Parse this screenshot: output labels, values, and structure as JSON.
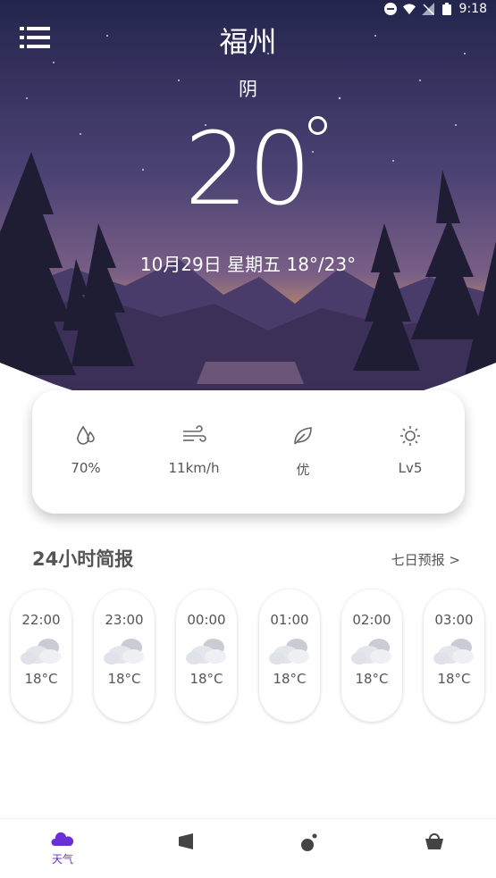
{
  "status": {
    "time": "9:18"
  },
  "header": {
    "city": "福州",
    "condition": "阴",
    "temperature": "20",
    "date_line": "10月29日  星期五  18°/23°"
  },
  "details": [
    {
      "icon": "humidity-icon",
      "value": "70%"
    },
    {
      "icon": "wind-icon",
      "value": "11km/h"
    },
    {
      "icon": "leaf-icon",
      "value": "优"
    },
    {
      "icon": "uv-sun-icon",
      "value": "Lv5"
    }
  ],
  "hourly_section": {
    "title": "24小时简报",
    "link": "七日预报  >"
  },
  "hourly": [
    {
      "time": "22:00",
      "temp": "18°C",
      "icon": "cloudy-icon"
    },
    {
      "time": "23:00",
      "temp": "18°C",
      "icon": "cloudy-icon"
    },
    {
      "time": "00:00",
      "temp": "18°C",
      "icon": "cloudy-icon"
    },
    {
      "time": "01:00",
      "temp": "18°C",
      "icon": "cloudy-icon"
    },
    {
      "time": "02:00",
      "temp": "18°C",
      "icon": "cloudy-icon"
    },
    {
      "time": "03:00",
      "temp": "18°C",
      "icon": "cloudy-icon"
    }
  ],
  "nav": [
    {
      "label": "天气",
      "icon": "cloud-icon",
      "active": true
    },
    {
      "label": "",
      "icon": "speaker-icon",
      "active": false
    },
    {
      "label": "",
      "icon": "planet-icon",
      "active": false
    },
    {
      "label": "",
      "icon": "basket-icon",
      "active": false
    }
  ],
  "colors": {
    "accent": "#6a2fd6",
    "sky_top": "#24264f",
    "sky_mid": "#5a4a7e",
    "sunset": "#c08a5a"
  }
}
